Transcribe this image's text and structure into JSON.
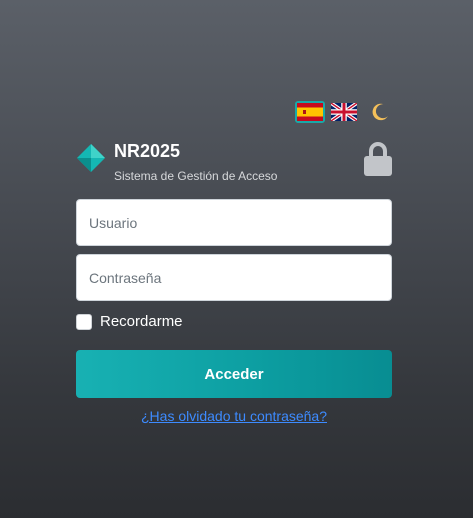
{
  "language_controls": {
    "spanish_flag_icon": "spain-flag-icon",
    "english_flag_icon": "uk-flag-icon",
    "theme_icon": "moon-icon"
  },
  "brand": {
    "title": "NR2025",
    "subtitle": "Sistema de Gestión de Acceso",
    "logo_icon": "diamond-logo-icon",
    "lock_icon": "lock-icon"
  },
  "form": {
    "username_placeholder": "Usuario",
    "username_value": "",
    "password_placeholder": "Contraseña",
    "password_value": "",
    "remember_label": "Recordarme",
    "remember_checked": false,
    "submit_label": "Acceder",
    "forgot_link": "¿Has olvidado tu contraseña?"
  },
  "colors": {
    "accent": "#0fa6a9",
    "link": "#3d8bff",
    "active_flag_border": "#18a9a9"
  }
}
